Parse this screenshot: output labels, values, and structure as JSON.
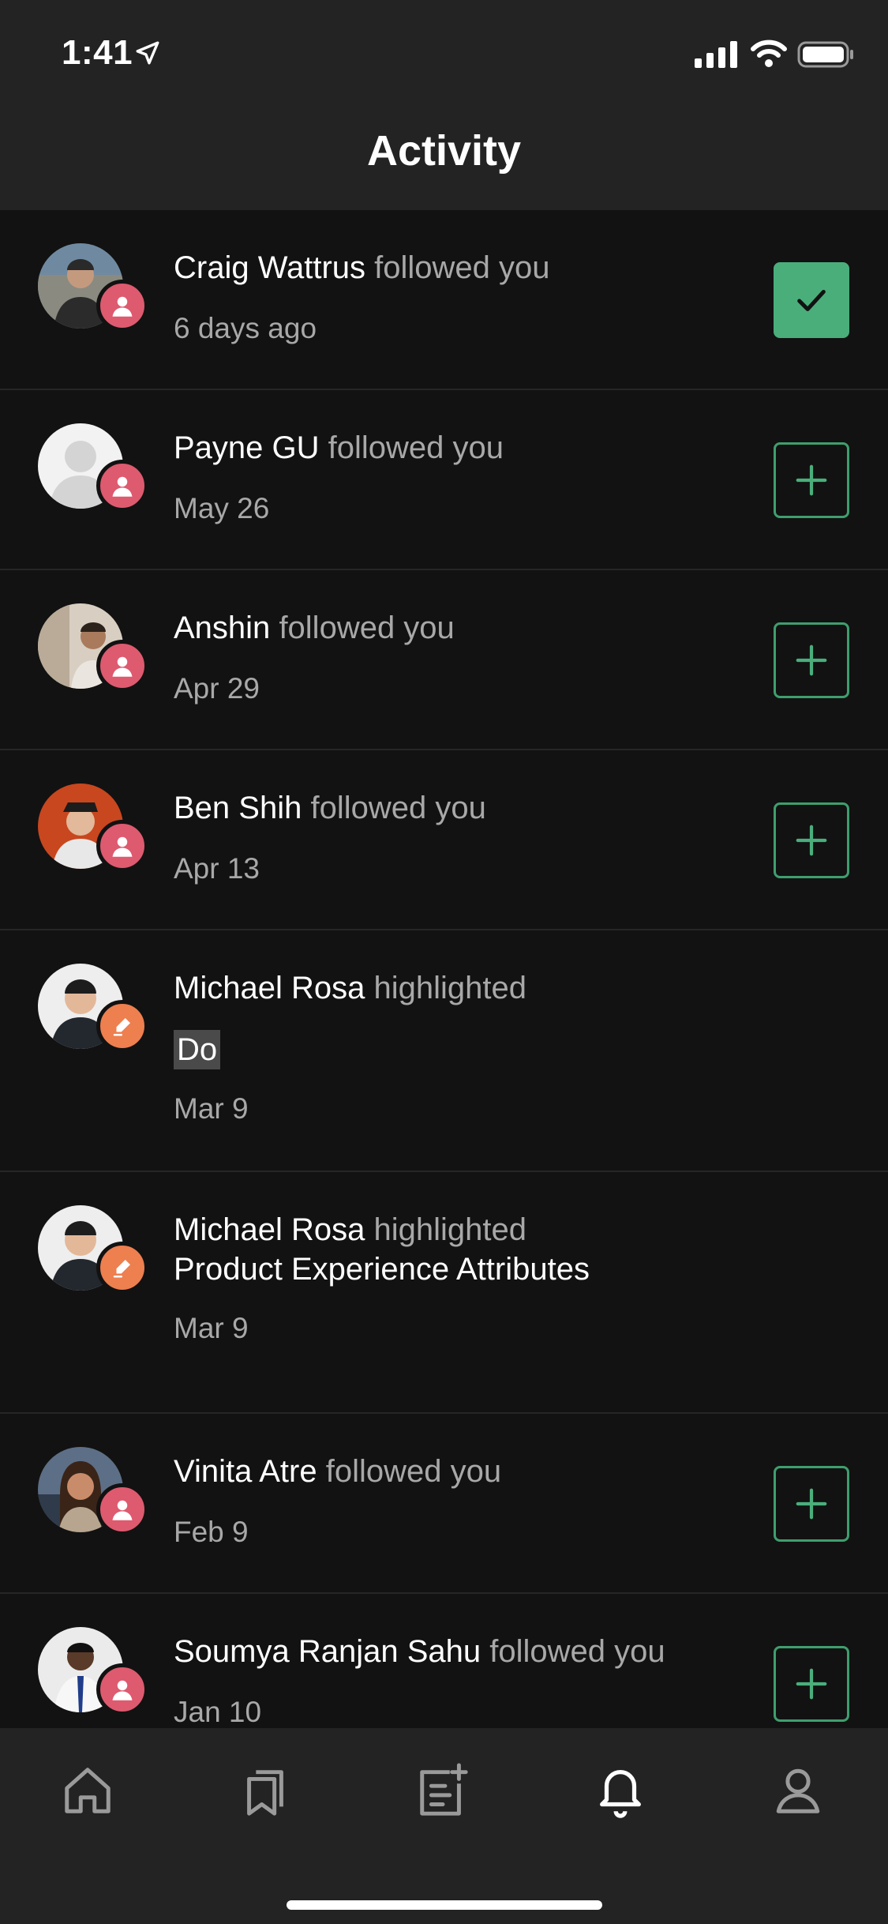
{
  "status_bar": {
    "time": "1:41"
  },
  "header": {
    "title": "Activity"
  },
  "colors": {
    "follow_badge": "#de5a6f",
    "highlight_badge": "#ee7f4f",
    "accent_green": "#4aae7b"
  },
  "activity": [
    {
      "actor": "Craig Wattrus",
      "verb": "followed you",
      "time": "6 days ago",
      "kind": "follow",
      "following": true
    },
    {
      "actor": "Payne GU",
      "verb": "followed you",
      "time": "May 26",
      "kind": "follow",
      "following": false
    },
    {
      "actor": "Anshin",
      "verb": "followed you",
      "time": "Apr 29",
      "kind": "follow",
      "following": false
    },
    {
      "actor": "Ben Shih",
      "verb": "followed you",
      "time": "Apr 13",
      "kind": "follow",
      "following": false
    },
    {
      "actor": "Michael Rosa",
      "verb": "highlighted",
      "snippet": "Do",
      "time": "Mar 9",
      "kind": "highlight"
    },
    {
      "actor": "Michael Rosa",
      "verb": "highlighted",
      "snippet": "Product Experience Attributes",
      "time": "Mar 9",
      "kind": "highlight"
    },
    {
      "actor": "Vinita Atre",
      "verb": "followed you",
      "time": "Feb 9",
      "kind": "follow",
      "following": false
    },
    {
      "actor": "Soumya Ranjan Sahu",
      "verb": "followed you",
      "time": "Jan 10",
      "kind": "follow",
      "following": false
    }
  ],
  "tabs": [
    {
      "icon": "home-icon",
      "active": false
    },
    {
      "icon": "bookmarks-icon",
      "active": false
    },
    {
      "icon": "write-icon",
      "active": false
    },
    {
      "icon": "bell-icon",
      "active": true
    },
    {
      "icon": "profile-icon",
      "active": false
    }
  ]
}
